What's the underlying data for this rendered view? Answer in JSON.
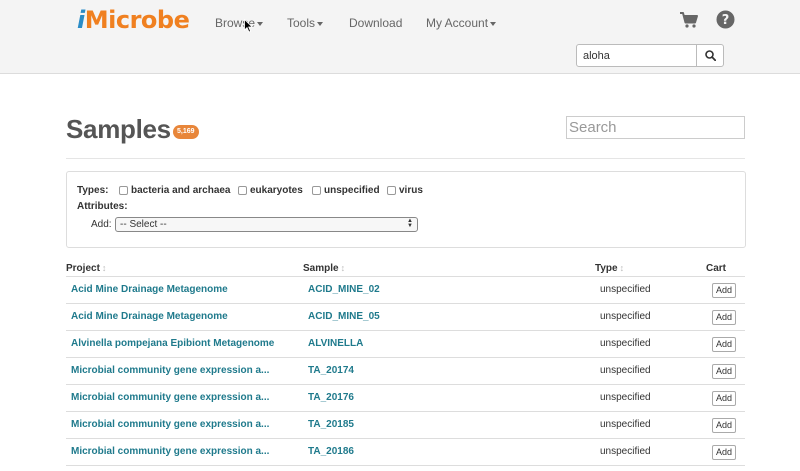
{
  "navbar": {
    "brand_prefix": "i",
    "brand_suffix": "Microbe",
    "items": [
      "Browse",
      "Tools",
      "Download",
      "My Account"
    ],
    "search_value": "aloha"
  },
  "page": {
    "title": "Samples",
    "count": "5,169",
    "search_placeholder": "Search"
  },
  "filters": {
    "types_label": "Types:",
    "types": [
      "bacteria and archaea",
      "eukaryotes",
      "unspecified",
      "virus"
    ],
    "attributes_label": "Attributes:",
    "add_label": "Add:",
    "select_value": "-- Select --"
  },
  "table": {
    "headers": {
      "project": "Project",
      "sample": "Sample",
      "type": "Type",
      "cart": "Cart"
    },
    "sort_glyph": "↕",
    "add_label": "Add",
    "rows": [
      {
        "project": "Acid Mine Drainage Metagenome",
        "sample": "ACID_MINE_02",
        "type": "unspecified"
      },
      {
        "project": "Acid Mine Drainage Metagenome",
        "sample": "ACID_MINE_05",
        "type": "unspecified"
      },
      {
        "project": "Alvinella pompejana Epibiont Metagenome",
        "sample": "ALVINELLA",
        "type": "unspecified"
      },
      {
        "project": "Microbial community gene expression a...",
        "sample": "TA_20174",
        "type": "unspecified"
      },
      {
        "project": "Microbial community gene expression a...",
        "sample": "TA_20176",
        "type": "unspecified"
      },
      {
        "project": "Microbial community gene expression a...",
        "sample": "TA_20185",
        "type": "unspecified"
      },
      {
        "project": "Microbial community gene expression a...",
        "sample": "TA_20186",
        "type": "unspecified"
      }
    ]
  },
  "icons": {
    "cart": "cart-icon",
    "help": "help-icon",
    "search": "search-icon"
  },
  "colors": {
    "brand_blue": "#2a8cc7",
    "brand_orange": "#f08020",
    "link": "#1f7a8c",
    "badge": "#e8863a"
  }
}
